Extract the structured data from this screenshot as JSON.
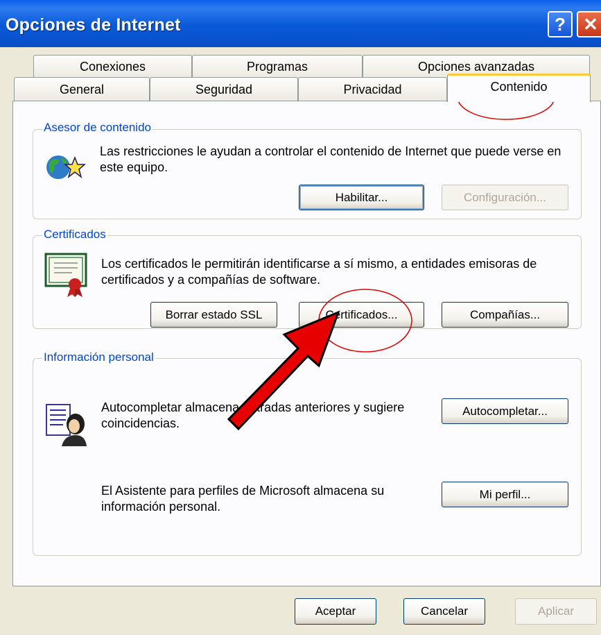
{
  "window": {
    "title": "Opciones de Internet",
    "help_label": "?",
    "close_label": "✕"
  },
  "tabs": {
    "row1": [
      "Conexiones",
      "Programas",
      "Opciones avanzadas"
    ],
    "row2": [
      "General",
      "Seguridad",
      "Privacidad",
      "Contenido"
    ],
    "active": "Contenido"
  },
  "content_advisor": {
    "label": "Asesor de contenido",
    "text": "Las restricciones le ayudan a controlar el contenido de Internet que puede verse en este equipo.",
    "enable_button": "Habilitar...",
    "settings_button": "Configuración..."
  },
  "certificates": {
    "label": "Certificados",
    "text": "Los certificados le permitirán identificarse a sí mismo, a entidades emisoras de certificados y a compañías de software.",
    "clear_ssl_button": "Borrar estado SSL",
    "certificates_button": "Certificados...",
    "publishers_button": "Compañías..."
  },
  "personal_info": {
    "label": "Información personal",
    "autocomplete_text": "Autocompletar almacena entradas anteriores y sugiere coincidencias.",
    "autocomplete_button": "Autocompletar...",
    "profile_text": "El Asistente para perfiles de Microsoft almacena su información personal.",
    "profile_button": "Mi perfil..."
  },
  "footer": {
    "ok_button": "Aceptar",
    "cancel_button": "Cancelar",
    "apply_button": "Aplicar"
  },
  "annotations": {
    "highlight_color": "#E00000",
    "arrow_color": "#E60000"
  }
}
